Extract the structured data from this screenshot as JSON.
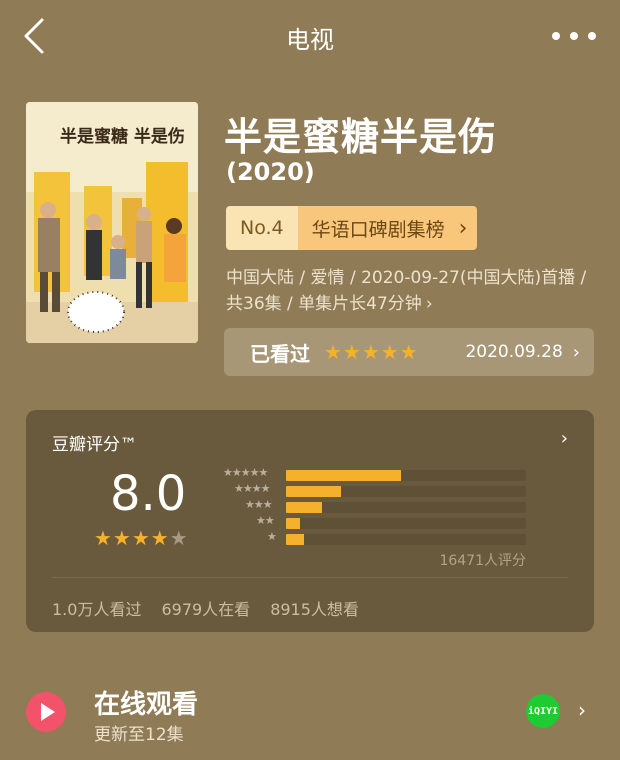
{
  "nav": {
    "title": "电视"
  },
  "movie": {
    "title": "半是蜜糖半是伤",
    "year": "(2020)",
    "poster_text": "半是蜜糖 半是伤"
  },
  "rank": {
    "number": "No.4",
    "name": "华语口碑剧集榜",
    "chevron": "›"
  },
  "meta": {
    "text": "中国大陆 / 爱情 / 2020-09-27(中国大陆)首播 / 共36集 / 单集片长47分钟",
    "chevron": "›"
  },
  "watched": {
    "label": "已看过",
    "stars": "★★★★★",
    "date": "2020.09.28",
    "chevron": "›"
  },
  "douban": {
    "header": "豆瓣评分™",
    "chevron": "›",
    "score": "8.0",
    "stars_on": "★★★★",
    "stars_off": "★",
    "distribution": [
      {
        "stars": "★★★★★",
        "fraction": 0.48
      },
      {
        "stars": "★★★★",
        "fraction": 0.23
      },
      {
        "stars": "★★★",
        "fraction": 0.15
      },
      {
        "stars": "★★",
        "fraction": 0.06
      },
      {
        "stars": "★",
        "fraction": 0.075
      }
    ],
    "rating_count": "16471人评分",
    "watched": "1.0万人看过",
    "watching": "6979人在看",
    "want": "8915人想看"
  },
  "online": {
    "title": "在线观看",
    "subtitle": "更新至12集",
    "provider_badge": "iQIYI",
    "chevron": "›"
  },
  "colors": {
    "background": "#8f7b55",
    "card": "#6a5a3d",
    "star": "#f6b12c",
    "play": "#f2536b",
    "iqiyi": "#1ecb32"
  }
}
